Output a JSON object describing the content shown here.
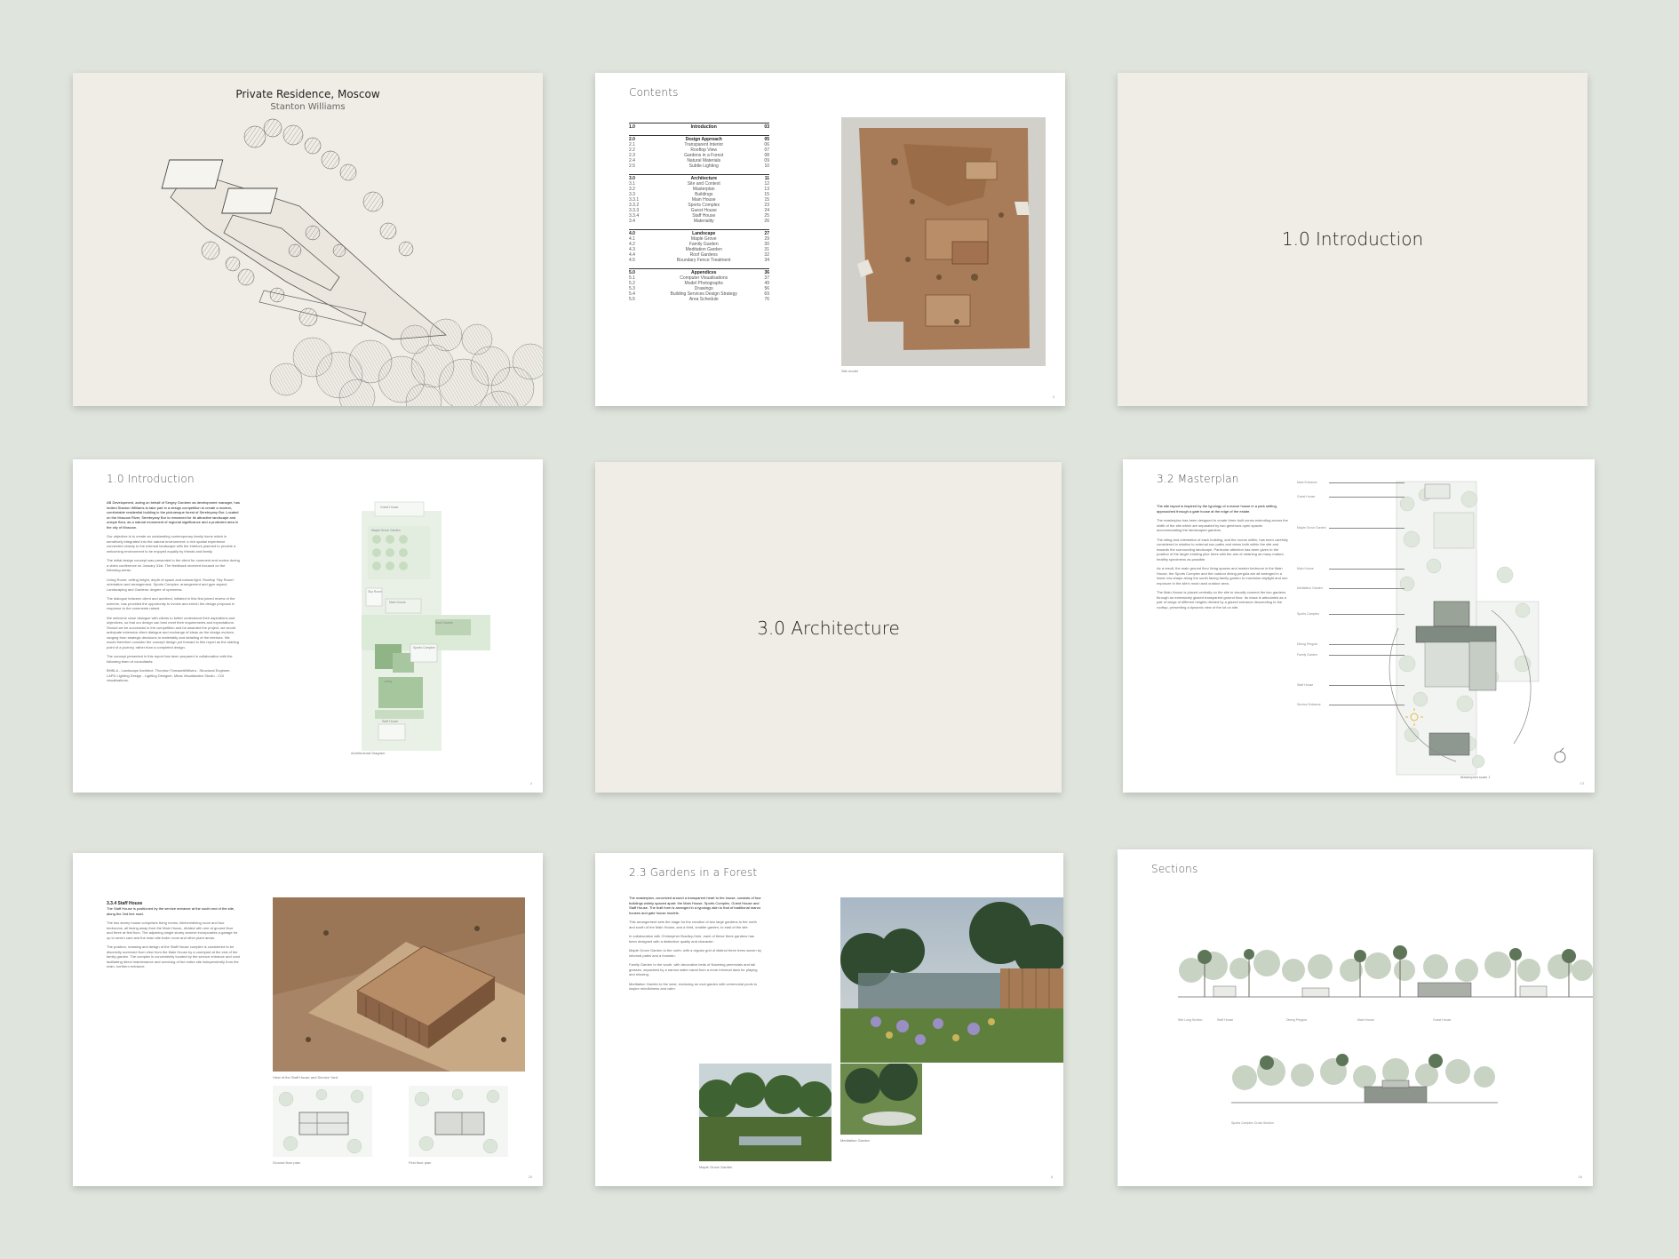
{
  "pages": {
    "p1": {
      "title": "Private Residence, Moscow",
      "subtitle": "Stanton Williams"
    },
    "p2": {
      "heading": "Contents",
      "caption": "Site model",
      "page_number": "3",
      "sections": [
        {
          "rows": [
            {
              "num": "1.0",
              "label": "Introduction",
              "page": "03",
              "h": true
            }
          ]
        },
        {
          "rows": [
            {
              "num": "2.0",
              "label": "Design Approach",
              "page": "05",
              "h": true
            },
            {
              "num": "2.1",
              "label": "Transparent Interior",
              "page": "06"
            },
            {
              "num": "2.2",
              "label": "Rooftop View",
              "page": "07"
            },
            {
              "num": "2.3",
              "label": "Gardens in a Forest",
              "page": "08"
            },
            {
              "num": "2.4",
              "label": "Natural Materials",
              "page": "09"
            },
            {
              "num": "2.5",
              "label": "Subtle Lighting",
              "page": "10"
            }
          ]
        },
        {
          "rows": [
            {
              "num": "3.0",
              "label": "Architecture",
              "page": "11",
              "h": true
            },
            {
              "num": "3.1",
              "label": "Site and Context",
              "page": "12"
            },
            {
              "num": "3.2",
              "label": "Masterplan",
              "page": "13"
            },
            {
              "num": "3.3",
              "label": "Buildings",
              "page": "15"
            },
            {
              "num": "3.3.1",
              "label": "Main House",
              "page": "15"
            },
            {
              "num": "3.3.2",
              "label": "Sports Complex",
              "page": "23"
            },
            {
              "num": "3.3.3",
              "label": "Guest House",
              "page": "24"
            },
            {
              "num": "3.3.4",
              "label": "Staff House",
              "page": "25"
            },
            {
              "num": "3.4",
              "label": "Materiality",
              "page": "26"
            }
          ]
        },
        {
          "rows": [
            {
              "num": "4.0",
              "label": "Landscape",
              "page": "27",
              "h": true
            },
            {
              "num": "4.1",
              "label": "Maple Grove",
              "page": "29"
            },
            {
              "num": "4.2",
              "label": "Family Garden",
              "page": "30"
            },
            {
              "num": "4.3",
              "label": "Meditation Garden",
              "page": "31"
            },
            {
              "num": "4.4",
              "label": "Roof Gardens",
              "page": "32"
            },
            {
              "num": "4.5",
              "label": "Boundary Fence Treatment",
              "page": "34"
            }
          ]
        },
        {
          "rows": [
            {
              "num": "5.0",
              "label": "Appendices",
              "page": "36",
              "h": true
            },
            {
              "num": "5.1",
              "label": "Computer Visualisations",
              "page": "37"
            },
            {
              "num": "5.2",
              "label": "Model Photographs",
              "page": "49"
            },
            {
              "num": "5.3",
              "label": "Drawings",
              "page": "56"
            },
            {
              "num": "5.4",
              "label": "Building Services Design Strategy",
              "page": "69"
            },
            {
              "num": "5.5",
              "label": "Area Schedule",
              "page": "76"
            }
          ]
        }
      ]
    },
    "p3": {
      "title": "1.0  Introduction"
    },
    "p4": {
      "heading": "1.0  Introduction",
      "page_number": "4",
      "paragraphs": [
        "AB Development, acting on behalf of Sergey Gordeev as development manager, has invited Stanton Williams to take part in a design competition to create a modern, comfortable residential building in the picturesque forest of Serebryany Bor. Located on the Moscow River, Serebryany Bor is renowned for its attractive landscape and unique flora, as a natural monument of regional significance and a protected area in the city of Moscow.",
        "Our objective is to create an outstanding contemporary family home which is sensitively integrated into the natural environment; a rich spatial experience connected closely to the external landscape with the interiors planned to provide a welcoming environment to be enjoyed equally by friends and family.",
        "The initial design concept was presented to the client for comment and review during a video conference on January 31st. The feedback received focused on the following areas:",
        "Living Room: ceiling height, depth of space and natural light. Rooftop 'Sky Room': orientation and arrangement. Sports Complex: arrangement and gym aspect. Landscaping and Gardens: degree of openness.",
        "The dialogue between client and architect, initiated in this first joined review of the scheme, has provided the opportunity to evolve and enrich the design proposal in response to the comments raised.",
        "We welcome close dialogue with clients to better understand their aspirations and objectives, so that our design can best meet their requirements and expectations. Should we be successful in the competition and be awarded the project, we would anticipate extensive client dialogue and exchange of ideas as the design evolves, ranging from strategic decisions to materiality and detailing of the interiors. We would therefore consider the concept design put forward in this report as the starting point of a journey, rather than a completed design.",
        "The concept presented in this report has been prepared in collaboration with the following team of consultants:",
        "BHBLA - Landscape Architect. Thornton Tomasetti/Mistra - Structural Engineer. LAPD Lighting Design - Lighting Designer. Miras Visualisation Studio - CGI visualisations."
      ],
      "diagram_caption": "Architectural Diagram",
      "diagram_labels": {
        "guest": "Guest House",
        "maple": "Maple Grove Garden",
        "sport": "Sports Complex",
        "sky": "Sky Room",
        "roof": "Roof Garden",
        "staff": "Staff House",
        "main": "Main House",
        "living": "Living"
      }
    },
    "p5": {
      "title": "3.0  Architecture"
    },
    "p6": {
      "heading": "3.2  Masterplan",
      "page_number": "13",
      "paragraphs": [
        "The site layout is inspired by the typology of a manor house in a park setting, approached through a gate house at the edge of the estate.",
        "The masterplan has been designed to create three built zones extending across the width of the site which are separated by two generous open spaces accommodating the landscaped gardens.",
        "The siting and orientation of each building, and the rooms within, has been carefully considered in relation to external sun paths and views both within the site and towards the surrounding landscape. Particular attention has been given to the position of the larger existing pine trees with the aim of retaining as many mature, healthy specimens as possible.",
        "As a result, the main ground floor living spaces and master bedroom in the Main House, the Sports Complex and the outdoor dining pergola are all arranged in a linear row shape along the south facing family garden to maximise daylight and sun exposure in the site's most used outdoor area.",
        "The Main House is placed centrally on the site to visually connect the two gardens through an extensively glazed transparent ground floor. Its mass is articulated as a pair of wings of different heights divided by a glazed entrance descending to the rooftop, presenting a dynamic view of the lot on site."
      ],
      "callouts": [
        "Main Entrance",
        "Guest House",
        "Maple Grove Garden",
        "Main House",
        "Meditation Garden",
        "Sports Complex",
        "Dining Pergola",
        "Family Garden",
        "Staff House",
        "Service Entrance"
      ],
      "caption": "Masterplan scale 1"
    },
    "p7": {
      "heading": "3.3.4  Staff House",
      "page_number": "25",
      "paragraphs": [
        "The Staff House is positioned by the service entrance at the south end of the site, along the 2nd line road.",
        "The two storey house comprises living rooms, kitchen/dining room and four bedrooms, all facing away from the Main House, divided with one at ground floor and three at first floor. The adjoining single storey annexe incorporates a garage for up to seven cars and the main site boiler room and other plant areas.",
        "The position, massing and design of the Staff House complex is considered to be discreetly screened from view from the Main House by a courtyard at the end of the family garden. The complex is conveniently located by the service entrance and road facilitating direct maintenance and servicing of the entire site independently from the main, northern entrance."
      ],
      "caption_main": "View of the Staff House and Service Yard",
      "caption_plan1": "Ground floor plan",
      "caption_plan2": "First floor plan"
    },
    "p8": {
      "heading": "2.3  Gardens in a Forest",
      "page_number": "8",
      "paragraphs": [
        "The masterplan, conceived around a transparent heart to the house, consists of four buildings widely spaced apart: the Main House, Sports Complex, Guest House and Staff House. The built form is arranged in a typology akin to that of traditional manor houses and gate house models.",
        "This arrangement sets the stage for the creation of two large gardens to the north and south of the Main House, and a third, smaller garden, to east of the site.",
        "In collaboration with Christopher Bradley-Hole, each of these three gardens has been designed with a distinctive quality and character:",
        "Maple Grove Garden to the north, with a regular grid of distinct three trees woven by informal paths and a fountain.",
        "Family Garden to the south, with decorative beds of flowering perennials and tall grasses, separated by a narrow water canal from a more informal lawn for playing and relaxing.",
        "Meditation Garden to the west, enclosing an oval garden with ceremonial pools to inspire mindfulness and calm."
      ],
      "caption_main": "Family Garden",
      "caption_small1": "Maple Grove Garden",
      "caption_small2": "Meditation Garden"
    },
    "p9": {
      "heading": "Sections",
      "page_number": "45",
      "labels1": [
        "Site Long Section",
        "Staff House",
        "Dining Pergola",
        "Main House",
        "Guest House"
      ],
      "labels2": [
        "Sports Complex Cross Section"
      ]
    }
  }
}
